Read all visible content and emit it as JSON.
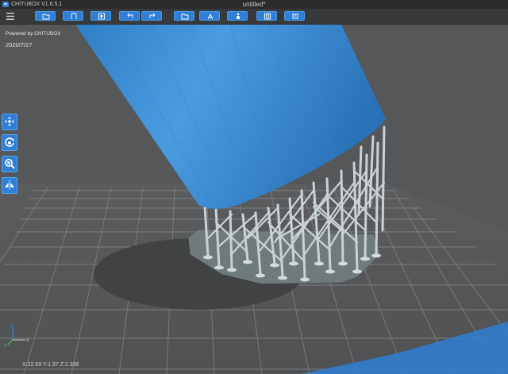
{
  "window": {
    "app_title": "CHITUBOX V1.6.5.1",
    "document_title": "untitled*"
  },
  "toolbar": {
    "menu_icon": "hamburger-icon",
    "buttons": [
      {
        "name": "open-file-button",
        "icon": "folder-open-icon"
      },
      {
        "name": "save-file-button",
        "icon": "save-icon"
      },
      {
        "name": "slice-settings-button",
        "icon": "settings-icon"
      },
      {
        "name": "undo-button",
        "icon": "undo-icon"
      },
      {
        "name": "redo-button",
        "icon": "redo-icon"
      },
      {
        "name": "import-button",
        "icon": "folder-icon"
      },
      {
        "name": "supports-button",
        "icon": "support-icon"
      },
      {
        "name": "hollow-button",
        "icon": "person-icon"
      },
      {
        "name": "view-button",
        "icon": "frame-icon"
      },
      {
        "name": "layout-button",
        "icon": "layout-icon"
      }
    ]
  },
  "viewport": {
    "powered_by": "Powered by CHITUBOX",
    "build_date": "2020/7/27",
    "status_text": "X:22.59 Y:1.97 Z:2.336",
    "side_tools": [
      {
        "name": "move-tool-button",
        "icon": "move-icon"
      },
      {
        "name": "rotate-tool-button",
        "icon": "rotate-icon"
      },
      {
        "name": "scale-tool-button",
        "icon": "zoom-icon"
      },
      {
        "name": "mirror-tool-button",
        "icon": "mirror-icon"
      }
    ]
  },
  "colors": {
    "background": "#555759",
    "plate_grid": "#8a8c8e",
    "model_blue": "#3d8fd6",
    "support_white": "#c9d2d6",
    "accent": "#2f7fd6",
    "toolbar": "#38393b"
  }
}
